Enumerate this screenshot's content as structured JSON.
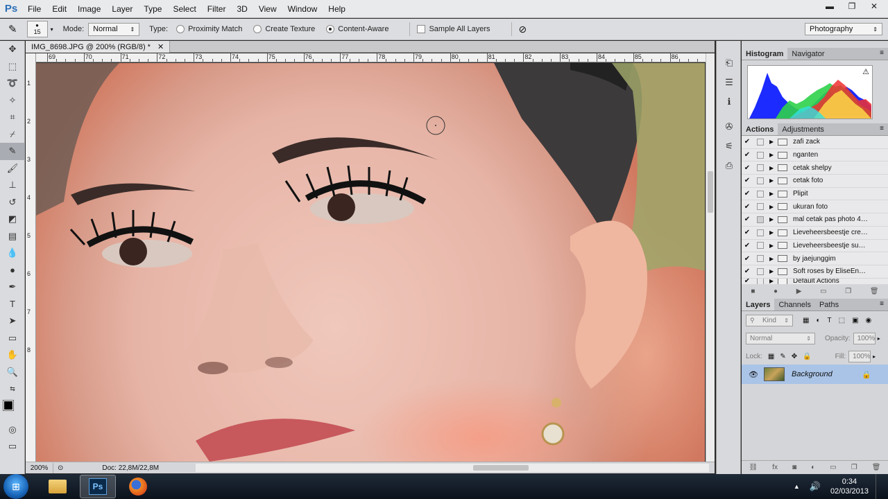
{
  "app": {
    "logo": "Ps"
  },
  "menu": [
    "File",
    "Edit",
    "Image",
    "Layer",
    "Type",
    "Select",
    "Filter",
    "3D",
    "View",
    "Window",
    "Help"
  ],
  "window_controls": {
    "minimize": "▬",
    "restore": "❐",
    "close": "✕"
  },
  "options": {
    "brush_size": "15",
    "mode_label": "Mode:",
    "mode_value": "Normal",
    "type_label": "Type:",
    "types": [
      "Proximity Match",
      "Create Texture",
      "Content-Aware"
    ],
    "selected_type": "Content-Aware",
    "sample_all_layers": "Sample All Layers",
    "workspace": "Photography"
  },
  "document": {
    "tab_title": "IMG_8698.JPG @ 200% (RGB/8) *",
    "ruler_h": [
      "69",
      "70",
      "71",
      "72",
      "73",
      "74",
      "75",
      "76",
      "77",
      "78",
      "79",
      "80",
      "81",
      "82",
      "83",
      "84",
      "85",
      "86"
    ],
    "ruler_v": [
      "1",
      "2",
      "3",
      "4",
      "5",
      "6",
      "7",
      "8"
    ],
    "zoom": "200%",
    "doc_size": "Doc: 22,8M/22,8M"
  },
  "histogram_panel": {
    "tabs": [
      "Histogram",
      "Navigator"
    ]
  },
  "actions_panel": {
    "tabs": [
      "Actions",
      "Adjustments"
    ],
    "items": [
      "zafi zack",
      "nganten",
      "cetak shelpy",
      "cetak foto",
      "Plipit",
      "ukuran foto",
      "mal cetak pas photo 4R...",
      "Lieveheersbeestje crea...",
      "Lieveheersbeestje sunn...",
      "by jaejunggim",
      "Soft roses by EliseEnch...",
      "Default Actions"
    ]
  },
  "layers_panel": {
    "tabs": [
      "Layers",
      "Channels",
      "Paths"
    ],
    "kind_filter": "Kind",
    "blend_mode": "Normal",
    "opacity_label": "Opacity:",
    "opacity_value": "100%",
    "lock_label": "Lock:",
    "fill_label": "Fill:",
    "fill_value": "100%",
    "layer_name": "Background"
  },
  "taskbar": {
    "apps": [
      "explorer",
      "photoshop",
      "firefox"
    ],
    "time": "0:34",
    "date": "02/03/2013"
  },
  "colors": {
    "accent": "#2a6fb6",
    "selection": "#a9c4e7"
  }
}
